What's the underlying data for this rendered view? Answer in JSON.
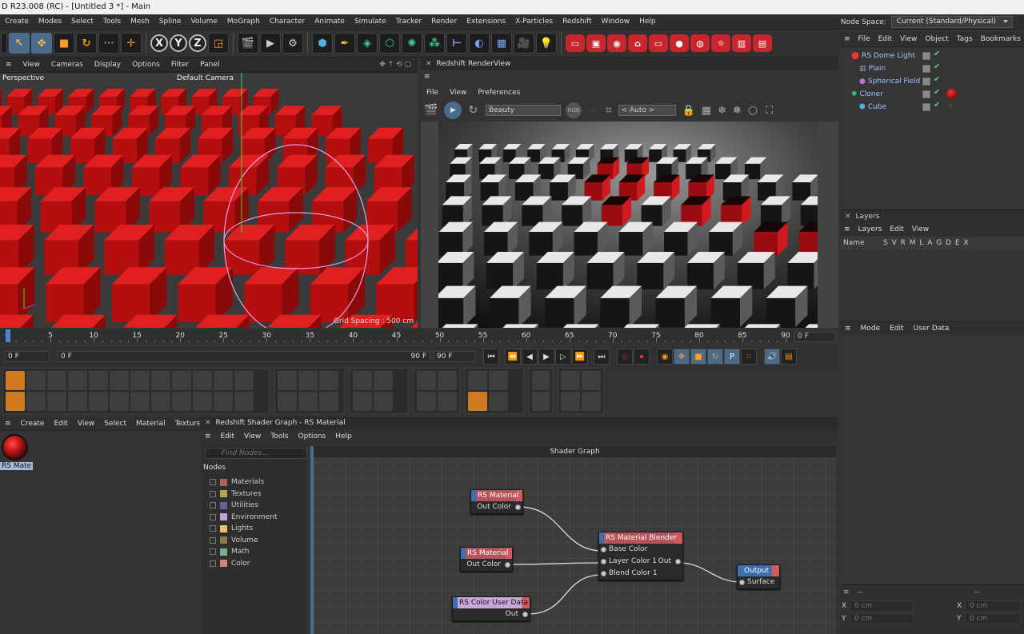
{
  "window": {
    "title": "D R23.008 (RC) - [Untitled 3 *] - Main"
  },
  "menubar": {
    "items": [
      "Create",
      "Modes",
      "Select",
      "Tools",
      "Mesh",
      "Spline",
      "Volume",
      "MoGraph",
      "Character",
      "Animate",
      "Simulate",
      "Tracker",
      "Render",
      "Extensions",
      "X-Particles",
      "Redshift",
      "Window",
      "Help"
    ],
    "node_space_label": "Node Space:",
    "node_space_value": "Current (Standard/Physical)"
  },
  "viewport": {
    "menu": [
      "View",
      "Cameras",
      "Display",
      "Options",
      "Filter",
      "Panel"
    ],
    "mode_label": "Perspective",
    "camera_label": "Default Camera",
    "grid_spacing": "Grid Spacing : 500 cm"
  },
  "renderview": {
    "title": "Redshift RenderView",
    "menu": [
      "File",
      "View",
      "Preferences"
    ],
    "aov_select": "Beauty",
    "rgb_label": "RGB",
    "zoom_select": "< Auto >"
  },
  "object_manager": {
    "menu": [
      "File",
      "Edit",
      "View",
      "Object",
      "Tags",
      "Bookmarks"
    ],
    "objects": [
      {
        "name": "RS Dome Light",
        "icon": "dome-light-icon"
      },
      {
        "name": "Plain",
        "icon": "plain-effector-icon"
      },
      {
        "name": "Spherical Field",
        "icon": "spherical-field-icon"
      },
      {
        "name": "Cloner",
        "icon": "cloner-icon"
      },
      {
        "name": "Cube",
        "icon": "cube-icon"
      }
    ]
  },
  "layers": {
    "title": "Layers",
    "menu": [
      "Layers",
      "Edit",
      "View"
    ],
    "col_name": "Name",
    "col_flags": "S V R M L A G D E X"
  },
  "attributes": {
    "menu": [
      "Mode",
      "Edit",
      "User Data"
    ],
    "dash1": "--",
    "dash2": "--",
    "coords": [
      {
        "axis": "X",
        "value": "0 cm"
      },
      {
        "axis": "X",
        "value": "0 cm"
      },
      {
        "axis": "Y",
        "value": "0 cm"
      },
      {
        "axis": "Y",
        "value": "0 cm"
      }
    ]
  },
  "timeline": {
    "ticks": [
      "0",
      "5",
      "10",
      "15",
      "20",
      "25",
      "30",
      "35",
      "40",
      "45",
      "50",
      "55",
      "60",
      "65",
      "70",
      "75",
      "80",
      "85",
      "90"
    ],
    "current_frame_right": "0 F",
    "start_frame": "0 F",
    "preview_start": "0 F",
    "preview_end": "90 F",
    "end_frame": "90 F"
  },
  "material_manager": {
    "menu": [
      "Create",
      "Edit",
      "View",
      "Select",
      "Material",
      "Texture"
    ],
    "material_name": "RS Mate"
  },
  "shader_graph": {
    "title": "Redshift Shader Graph - RS Material",
    "menu": [
      "Edit",
      "View",
      "Tools",
      "Options",
      "Help"
    ],
    "search_placeholder": "Find Nodes...",
    "nodes_header": "Nodes",
    "categories": [
      {
        "label": "Materials",
        "color": "#b25c5c"
      },
      {
        "label": "Textures",
        "color": "#b8a34a"
      },
      {
        "label": "Utilities",
        "color": "#6a5e9c"
      },
      {
        "label": "Environment",
        "color": "#b8a8d8"
      },
      {
        "label": "Lights",
        "color": "#e8c070"
      },
      {
        "label": "Volume",
        "color": "#8a7a4a"
      },
      {
        "label": "Math",
        "color": "#78b088"
      },
      {
        "label": "Color",
        "color": "#d88080"
      }
    ],
    "canvas_title": "Shader Graph",
    "node_rs_material_1": {
      "title": "RS Material",
      "port": "Out Color"
    },
    "node_rs_material_2": {
      "title": "RS Material",
      "port": "Out Color"
    },
    "node_color_user": {
      "title": "RS Color User Data",
      "port": "Out"
    },
    "node_blender": {
      "title": "RS Material Blender",
      "ports": [
        "Base Color",
        "Layer Color 1",
        "Blend Color 1"
      ],
      "out": "Out"
    },
    "node_output": {
      "title": "Output",
      "port": "Surface"
    }
  },
  "colors": {
    "accent": "#4a84d4",
    "redshift": "#c8262c",
    "cube_red": "#b01010"
  }
}
